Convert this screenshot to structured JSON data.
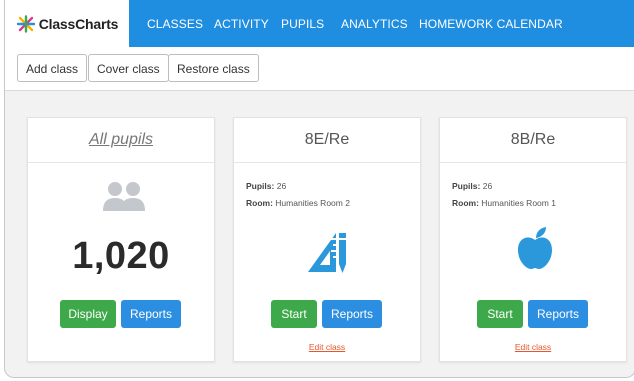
{
  "app": {
    "logo_text": "ClassCharts",
    "brand_color": "#1f8de0"
  },
  "nav": {
    "items": [
      "CLASSES",
      "ACTIVITY",
      "PUPILS",
      "ANALYTICS",
      "HOMEWORK CALENDAR"
    ]
  },
  "toolbar": {
    "add_class": "Add class",
    "cover_class": "Cover class",
    "restore_class": "Restore class"
  },
  "cards": {
    "all": {
      "title": "All pupils",
      "count": "1,020",
      "icon": "people-icon",
      "display_label": "Display",
      "reports_label": "Reports"
    },
    "c1": {
      "title": "8E/Re",
      "pupils_label": "Pupils:",
      "pupils_value": "26",
      "room_label": "Room:",
      "room_value": "Humanities Room 2",
      "icon": "ruler-pencil-icon",
      "start_label": "Start",
      "reports_label": "Reports",
      "edit_label": "Edit class"
    },
    "c2": {
      "title": "8B/Re",
      "pupils_label": "Pupils:",
      "pupils_value": "26",
      "room_label": "Room:",
      "room_value": "Humanities Room 1",
      "icon": "apple-icon",
      "start_label": "Start",
      "reports_label": "Reports",
      "edit_label": "Edit class"
    }
  },
  "colors": {
    "start_green": "#3da94a",
    "reports_blue": "#2c8ee0",
    "icon_gray": "#c4c8cc",
    "icon_blue": "#2b98dc",
    "edit_link": "#e8562a"
  }
}
